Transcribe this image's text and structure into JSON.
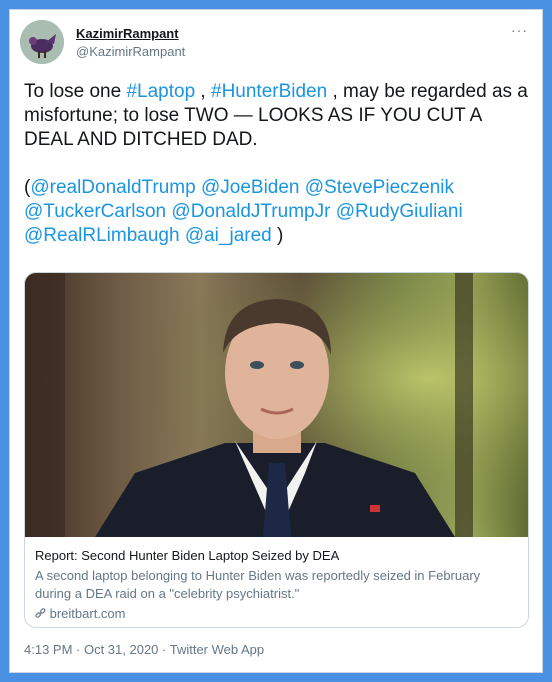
{
  "author": {
    "display_name": "KazimirRampant",
    "handle": "@KazimirRampant"
  },
  "more_icon": "more-horizontal-icon",
  "more_label": "···",
  "tweet": {
    "line1_pre": "To lose one ",
    "hashtag1": "#Laptop",
    "line1_mid": " , ",
    "hashtag2": "#HunterBiden",
    "line1_post": " , may be regarded as a misfortune; to lose TWO — LOOKS AS IF YOU CUT A DEAL AND DITCHED DAD.",
    "paren_open": "(",
    "mentions": [
      "@realDonaldTrump",
      "@JoeBiden",
      "@StevePieczenik",
      "@TuckerCarlson",
      "@DonaldJTrumpJr",
      "@RudyGiuliani",
      "@RealRLimbaugh",
      "@ai_jared"
    ],
    "paren_close": " )"
  },
  "link_card": {
    "title": "Report: Second Hunter Biden Laptop Seized by DEA",
    "description": "A second laptop belonging to Hunter Biden was reportedly seized in February during a DEA raid on a \"celebrity psychiatrist.\"",
    "domain": "breitbart.com",
    "link_icon": "link-icon"
  },
  "footer": {
    "timestamp": "4:13 PM · Oct 31, 2020 · Twitter Web App"
  },
  "colors": {
    "frame": "#4a90e2",
    "link": "#1b95e0",
    "text": "#14171a",
    "muted": "#657786"
  }
}
